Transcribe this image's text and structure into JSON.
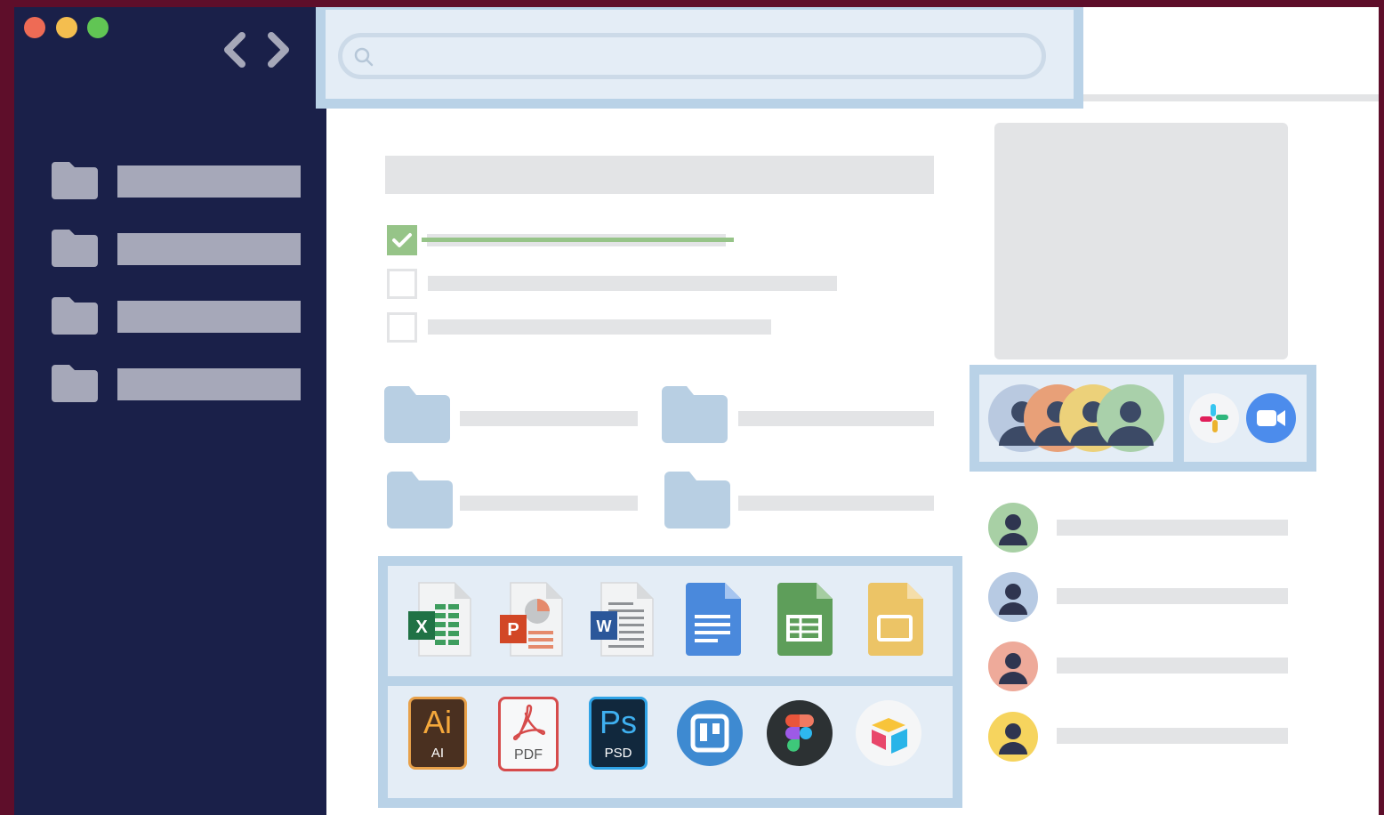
{
  "sidebar": {
    "items": [
      {
        "icon": "folder-icon"
      },
      {
        "icon": "folder-icon"
      },
      {
        "icon": "folder-icon"
      },
      {
        "icon": "folder-icon"
      }
    ]
  },
  "search": {
    "placeholder": ""
  },
  "apps_row1": [
    "excel-icon",
    "powerpoint-icon",
    "word-icon",
    "google-docs-icon",
    "google-sheets-icon",
    "google-slides-icon"
  ],
  "apps_row2": {
    "ai_label": "Ai",
    "ai_sub": "AI",
    "pdf_label": "PDF",
    "ps_label": "Ps",
    "psd_label": "PSD"
  },
  "colors": {
    "sidebar": "#1a2049",
    "panel": "#e4edf6",
    "panel_border": "#b9d2e7",
    "check": "#96c488"
  }
}
